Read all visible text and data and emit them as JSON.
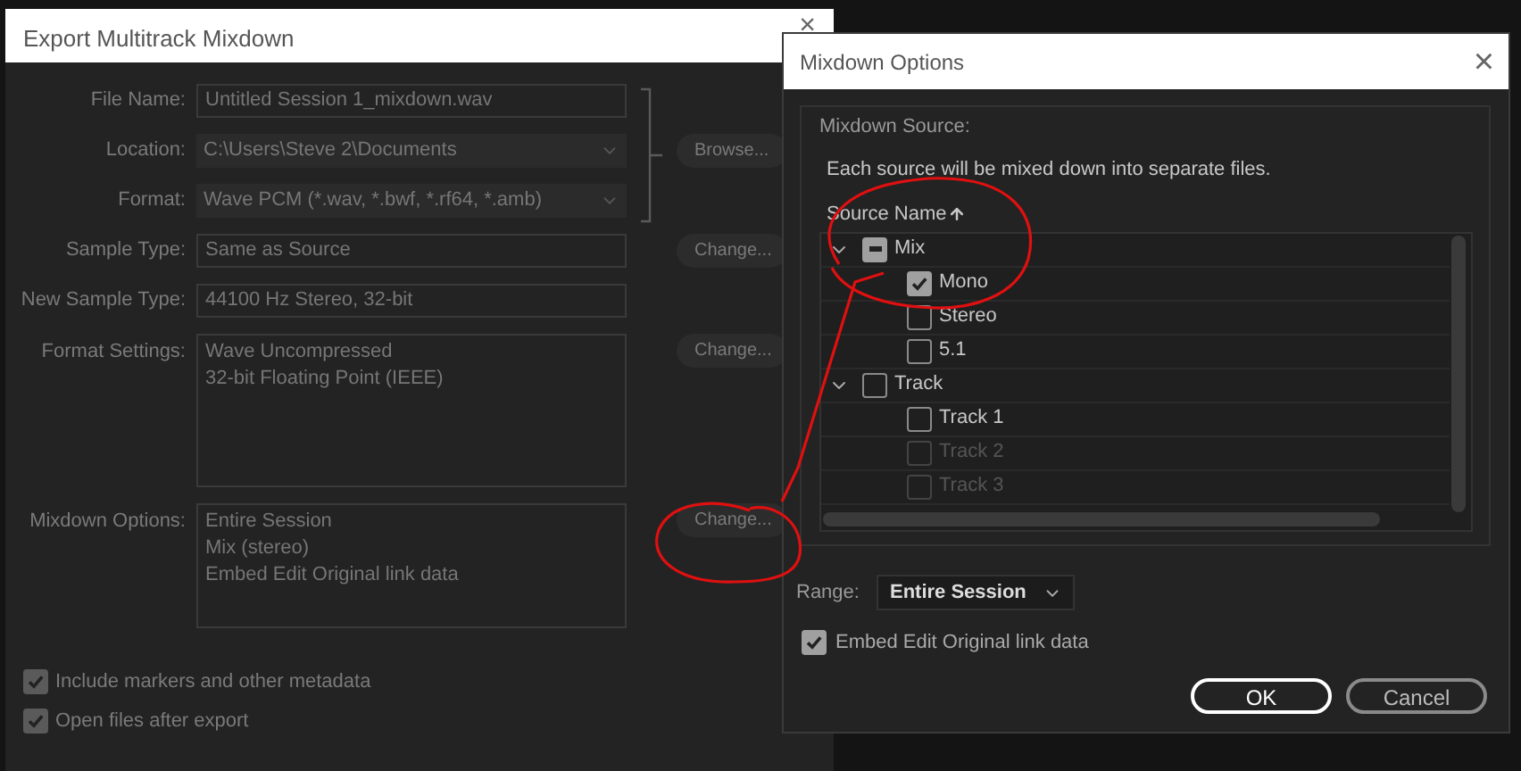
{
  "export_dialog": {
    "title": "Export Multitrack Mixdown",
    "close": "×",
    "disabled": true,
    "fields": [
      {
        "kind": "text",
        "label": "File Name:",
        "value": "Untitled Session 1_mixdown.wav"
      },
      {
        "kind": "dropdown",
        "label": "Location:",
        "value": "C:\\Users\\Steve 2\\Documents",
        "button": "Browse..."
      },
      {
        "kind": "dropdown",
        "label": "Format:",
        "value": "Wave PCM (*.wav, *.bwf, *.rf64, *.amb)"
      },
      {
        "kind": "text",
        "label": "Sample Type:",
        "value": "Same as Source",
        "button": "Change..."
      },
      {
        "kind": "text",
        "label": "New Sample Type:",
        "value": "44100 Hz Stereo, 32-bit"
      },
      {
        "kind": "area",
        "label": "Format Settings:",
        "lines": [
          "Wave Uncompressed",
          "32-bit Floating Point (IEEE)"
        ],
        "button": "Change..."
      },
      {
        "kind": "area",
        "label": "Mixdown Options:",
        "lines": [
          "Entire Session",
          "Mix (stereo)",
          "Embed Edit Original link data"
        ],
        "button": "Change..."
      }
    ],
    "checkboxes": [
      {
        "label": "Include markers and other metadata",
        "checked": true
      },
      {
        "label": "Open files after export",
        "checked": true
      }
    ]
  },
  "mixdown_options": {
    "title": "Mixdown Options",
    "close": "×",
    "group_label": "Mixdown Source:",
    "description": "Each source will be mixed down into separate files.",
    "column_header": "Source Name",
    "tree": [
      {
        "label": "Mix",
        "expanded": true,
        "checked": false,
        "partial": true,
        "disabled": false,
        "children": [
          {
            "label": "Mono",
            "checked": true,
            "partial": false,
            "disabled": false
          },
          {
            "label": "Stereo",
            "checked": false,
            "partial": false,
            "disabled": false
          },
          {
            "label": "5.1",
            "checked": false,
            "partial": false,
            "disabled": false
          }
        ]
      },
      {
        "label": "Track",
        "expanded": true,
        "checked": false,
        "partial": false,
        "disabled": false,
        "children": [
          {
            "label": "Track 1",
            "checked": false,
            "partial": false,
            "disabled": false
          },
          {
            "label": "Track 2",
            "checked": false,
            "partial": false,
            "disabled": true
          },
          {
            "label": "Track 3",
            "checked": false,
            "partial": false,
            "disabled": true
          }
        ]
      }
    ],
    "range": {
      "label": "Range:",
      "value": "Entire Session"
    },
    "embed": {
      "label": "Embed Edit Original link data",
      "checked": true
    },
    "buttons": [
      {
        "label": "OK",
        "primary": true
      },
      {
        "label": "Cancel",
        "primary": false
      }
    ]
  }
}
